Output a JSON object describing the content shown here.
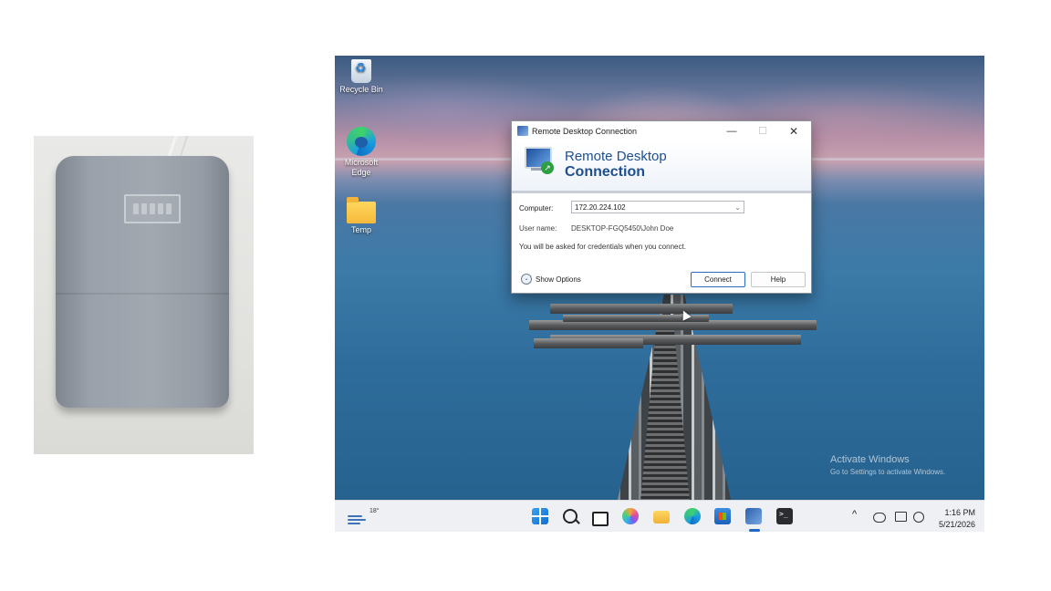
{
  "desktop": {
    "icons": [
      {
        "label": "Recycle Bin",
        "icon": "recycle-bin-icon"
      },
      {
        "label": "Microsoft Edge",
        "icon": "edge-icon"
      },
      {
        "label": "Temp",
        "icon": "folder-icon"
      }
    ],
    "watermark": {
      "title": "Activate Windows",
      "subtitle": "Go to Settings to activate Windows."
    }
  },
  "taskbar": {
    "weather_temp": "18°",
    "apps": [
      "start-icon",
      "search-icon",
      "task-view-icon",
      "copilot-icon",
      "file-explorer-icon",
      "edge-icon",
      "store-icon",
      "remote-desktop-icon",
      "terminal-icon"
    ],
    "tray": {
      "chevron": "^",
      "clock_time": "1:16 PM",
      "clock_date": "5/21/2026"
    }
  },
  "rdp_dialog": {
    "title": "Remote Desktop Connection",
    "min_glyph": "—",
    "max_glyph": "☐",
    "close_glyph": "✕",
    "banner_line1": "Remote Desktop",
    "banner_line2": "Connection",
    "computer_label": "Computer:",
    "computer_value": "172.20.224.102",
    "dropdown_glyph": "⌄",
    "username_label": "User name:",
    "username_value": "DESKTOP-FGQ5450\\John Doe",
    "note": "You will be asked for credentials when you connect.",
    "show_options_label": "Show Options",
    "show_options_glyph": "⌄",
    "connect_label": "Connect",
    "help_label": "Help"
  },
  "colors": {
    "accent": "#1f4f91",
    "taskbar": "#eef0f4"
  }
}
